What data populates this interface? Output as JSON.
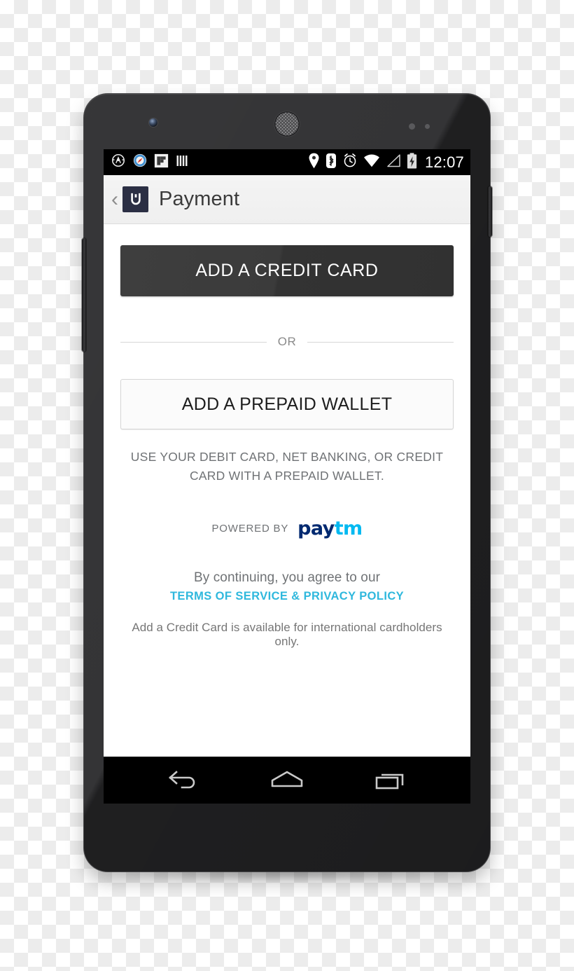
{
  "device": {
    "name": "android-smartphone",
    "hardware": {
      "front_camera": "front-camera",
      "earpiece": "earpiece-speaker",
      "proximity_sensor": "proximity-sensor",
      "light_sensor": "light-sensor",
      "volume_rocker": "volume-rocker",
      "power_button": "power-button"
    }
  },
  "status_bar": {
    "background": "#000000",
    "clock": "12:07",
    "left_icons": [
      {
        "name": "app-notification-icon",
        "label": "circle-arrow"
      },
      {
        "name": "browser-compass-icon",
        "label": "compass"
      },
      {
        "name": "flipboard-icon",
        "label": "flipboard"
      },
      {
        "name": "bars-icon",
        "label": "vertical-bars"
      }
    ],
    "right_icons": [
      {
        "name": "location-pin-icon",
        "label": "location"
      },
      {
        "name": "bluetooth-icon",
        "label": "bluetooth"
      },
      {
        "name": "alarm-clock-icon",
        "label": "alarm"
      },
      {
        "name": "wifi-icon",
        "label": "wifi"
      },
      {
        "name": "cellular-signal-icon",
        "label": "signal"
      },
      {
        "name": "battery-charging-icon",
        "label": "battery-charging"
      }
    ]
  },
  "header": {
    "back_chevron": "‹",
    "logo_name": "uber-logo",
    "logo_color": "#2b2f44",
    "title": "Payment"
  },
  "main": {
    "add_credit_card_label": "ADD A CREDIT CARD",
    "or_label": "OR",
    "add_prepaid_wallet_label": "ADD A PREPAID WALLET",
    "wallet_help_text": "USE YOUR DEBIT CARD, NET BANKING, OR CREDIT CARD WITH A PREPAID WALLET.",
    "powered_by_label": "POWERED BY",
    "paytm": {
      "part_one": "pay",
      "part_two": "tm",
      "part_one_color": "#002970",
      "part_two_color": "#00b9f1"
    },
    "agreement_text": "By continuing, you agree to our",
    "terms_link_label": "TERMS OF SERVICE & PRIVACY POLICY",
    "terms_link_color": "#2fb8dd",
    "international_note": "Add a Credit Card is available for international cardholders only."
  },
  "nav_bar": {
    "background": "#000000",
    "buttons": [
      {
        "name": "nav-back-button",
        "label": "back"
      },
      {
        "name": "nav-home-button",
        "label": "home"
      },
      {
        "name": "nav-recents-button",
        "label": "recent-apps"
      }
    ]
  },
  "colors": {
    "primary_button": "#353535",
    "screen_background": "#ffffff",
    "header_background": "#f1f1f1",
    "muted_text": "#6f7275",
    "accent": "#2fb8dd"
  }
}
